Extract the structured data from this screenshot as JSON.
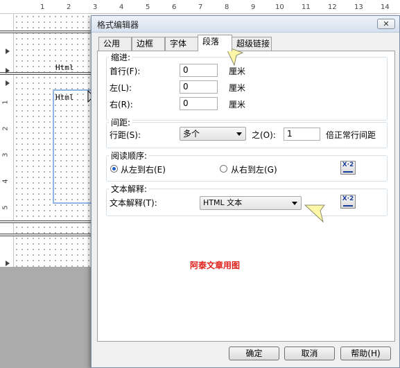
{
  "ruler": {
    "ticks": [
      "1",
      "2",
      "3",
      "4",
      "5",
      "6",
      "7",
      "8",
      "9",
      "10",
      "11",
      "12",
      "13",
      "14"
    ],
    "left_ticks": [
      "1",
      "2",
      "3",
      "4",
      "5"
    ]
  },
  "designer": {
    "label_1": "Html",
    "label_2": "Html"
  },
  "dialog": {
    "title": "格式编辑器",
    "close_label": "✕",
    "tabs": [
      "公用",
      "边框",
      "字体",
      "段落",
      "超级链接"
    ],
    "active_tab": "段落",
    "indent": {
      "title": "缩进:",
      "first_line_label": "首行(F):",
      "first_line_value": "0",
      "left_label": "左(L):",
      "left_value": "0",
      "right_label": "右(R):",
      "right_value": "0",
      "unit": "厘米"
    },
    "spacing": {
      "title": "间距:",
      "line_spacing_label": "行距(S):",
      "line_spacing_value": "多个",
      "of_label": "之(O):",
      "of_value": "1",
      "suffix": "倍正常行间距"
    },
    "reading_order": {
      "title": "阅读顺序:",
      "ltr_label": "从左到右(E)",
      "rtl_label": "从右到左(G)",
      "selected": "ltr"
    },
    "text_interpretation": {
      "title": "文本解释:",
      "label": "文本解释(T):",
      "value": "HTML 文本"
    },
    "formula_button": "X·2",
    "buttons": {
      "ok": "确定",
      "cancel": "取消",
      "help": "帮助(H)"
    }
  },
  "watermark": "阿泰文章用图",
  "colors": {
    "accent": "#1f5fbf",
    "watermark": "#e0201b",
    "selection": "#8fb6e6",
    "callout": "#fff7a8"
  }
}
